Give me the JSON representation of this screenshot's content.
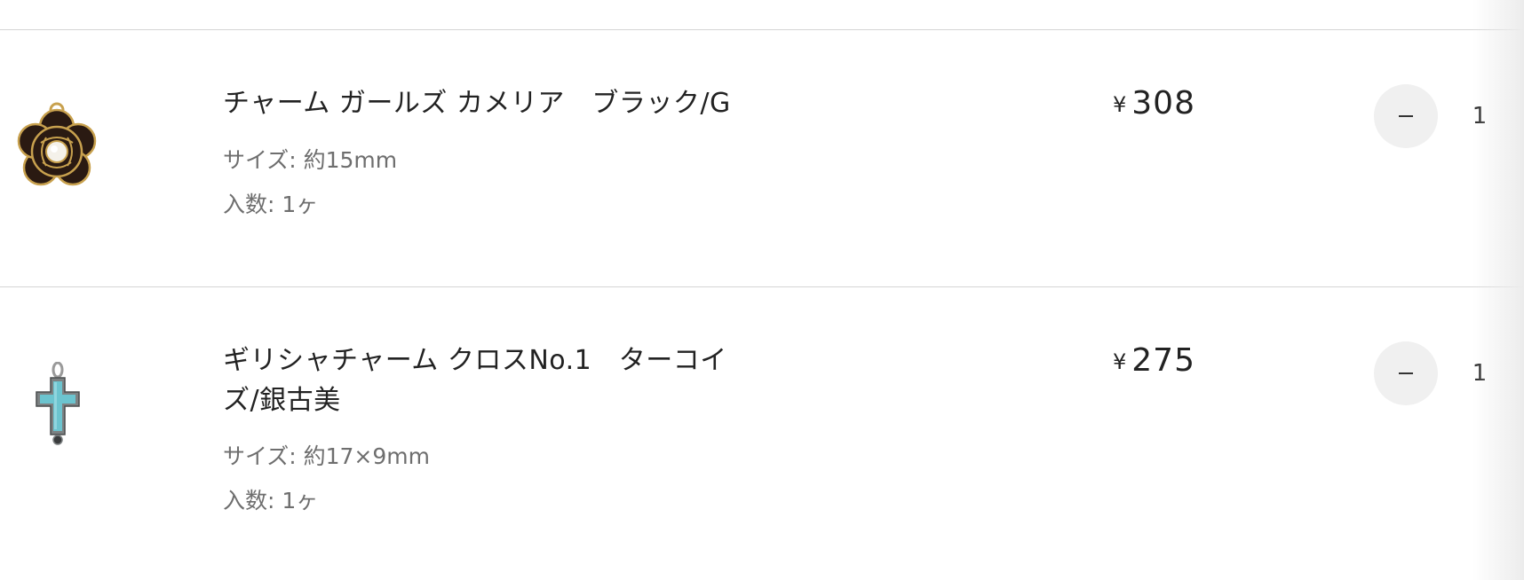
{
  "cart": {
    "items": [
      {
        "name": "チャーム ガールズ カメリア　ブラック/G",
        "size": "サイズ: 約15mm",
        "count": "入数: 1ヶ",
        "currency": "¥",
        "price": "308",
        "quantity": "1",
        "thumbnail_icon": "camellia-charm-icon"
      },
      {
        "name": "ギリシャチャーム クロスNo.1　ターコイズ/銀古美",
        "size": "サイズ: 約17×9mm",
        "count": "入数: 1ヶ",
        "currency": "¥",
        "price": "275",
        "quantity": "1",
        "thumbnail_icon": "turquoise-cross-charm-icon"
      }
    ]
  },
  "colors": {
    "divider": "#d5d5d5",
    "qty_button_bg": "#f0f0f0",
    "meta_text": "#6e6e6e",
    "turquoise": "#6cc4cf"
  }
}
